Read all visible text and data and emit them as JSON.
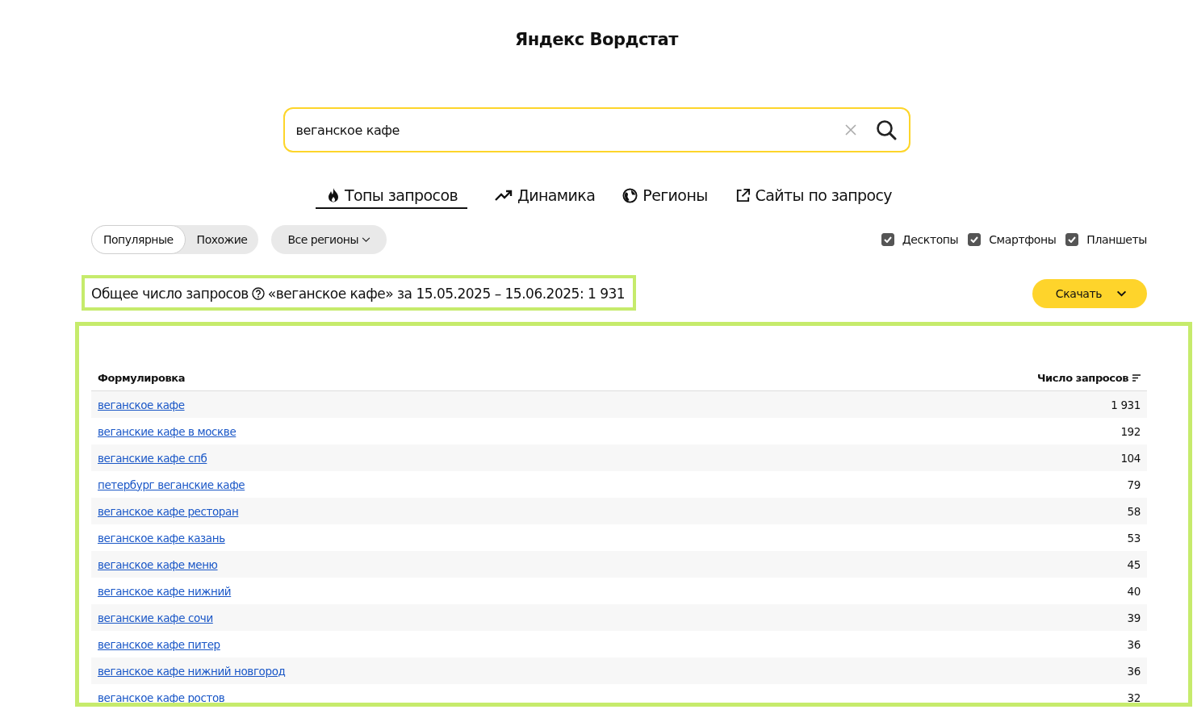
{
  "header": {
    "title": "Яндекс Вордстат"
  },
  "search": {
    "value": "веганское кафе"
  },
  "tabs": [
    {
      "label": "Топы запросов",
      "selected": true
    },
    {
      "label": "Динамика",
      "selected": false
    },
    {
      "label": "Регионы",
      "selected": false
    },
    {
      "label": "Сайты по запросу",
      "selected": false
    }
  ],
  "mode_switch": [
    {
      "label": "Популярные",
      "selected": true
    },
    {
      "label": "Похожие",
      "selected": false
    }
  ],
  "region_select": {
    "label": "Все регионы"
  },
  "devices": [
    {
      "label": "Десктопы",
      "checked": true
    },
    {
      "label": "Смартфоны",
      "checked": true
    },
    {
      "label": "Планшеты",
      "checked": true
    }
  ],
  "summary": {
    "label": "Общее число запросов",
    "text": "«веганское кафе» за 15.05.2025 – 15.06.2025: 1 931"
  },
  "download_button": {
    "label": "Скачать"
  },
  "table": {
    "columns": [
      "Формулировка",
      "Число запросов"
    ],
    "rows": [
      {
        "phrase": "веганское кафе",
        "count": "1 931"
      },
      {
        "phrase": "веганские кафе в москве",
        "count": "192"
      },
      {
        "phrase": "веганские кафе спб",
        "count": "104"
      },
      {
        "phrase": "петербург веганские кафе",
        "count": "79"
      },
      {
        "phrase": "веганское кафе ресторан",
        "count": "58"
      },
      {
        "phrase": "веганское кафе казань",
        "count": "53"
      },
      {
        "phrase": "веганское кафе меню",
        "count": "45"
      },
      {
        "phrase": "веганское кафе нижний",
        "count": "40"
      },
      {
        "phrase": "веганские кафе сочи",
        "count": "39"
      },
      {
        "phrase": "веганское кафе питер",
        "count": "36"
      },
      {
        "phrase": "веганское кафе нижний новгород",
        "count": "36"
      },
      {
        "phrase": "веганское кафе ростов",
        "count": "32"
      }
    ]
  }
}
